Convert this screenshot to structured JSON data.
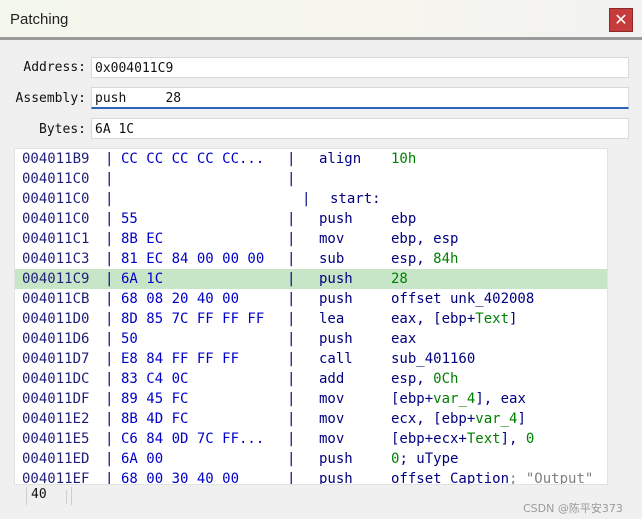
{
  "window": {
    "title": "Patching",
    "close_glyph": "✕"
  },
  "fields": {
    "address": {
      "label": "Address:",
      "value": "0x004011C9"
    },
    "assembly": {
      "label": "Assembly:",
      "value": "push     28"
    },
    "bytes": {
      "label": "Bytes:",
      "value": "6A 1C"
    }
  },
  "listing": [
    {
      "addr": "004011B9",
      "bytes": "CC CC CC CC CC...",
      "bar": "|",
      "mn": "align",
      "op": [
        {
          "t": "10h",
          "c": "num"
        }
      ]
    },
    {
      "addr": "004011C0",
      "bytes": "",
      "bar": "|",
      "mn": "",
      "op": []
    },
    {
      "addr": "004011C0",
      "bytes": "",
      "bar": "|",
      "label": "start:",
      "mn": "",
      "op": []
    },
    {
      "addr": "004011C0",
      "bytes": "55",
      "bar": "",
      "mn": "push",
      "op": [
        {
          "t": "ebp",
          "c": ""
        }
      ]
    },
    {
      "addr": "004011C1",
      "bytes": "8B EC",
      "bar": "",
      "mn": "mov",
      "op": [
        {
          "t": "ebp, esp",
          "c": ""
        }
      ]
    },
    {
      "addr": "004011C3",
      "bytes": "81 EC 84 00 00 00",
      "bar": "",
      "mn": "sub",
      "op": [
        {
          "t": "esp, ",
          "c": ""
        },
        {
          "t": "84h",
          "c": "num"
        }
      ]
    },
    {
      "addr": "004011C9",
      "bytes": "6A 1C",
      "bar": "|",
      "mn": "push",
      "op": [
        {
          "t": "28",
          "c": "num"
        }
      ],
      "selected": true
    },
    {
      "addr": "004011CB",
      "bytes": "68 08 20 40 00",
      "bar": "|",
      "mn": "push",
      "op": [
        {
          "t": "offset unk_402008",
          "c": ""
        }
      ]
    },
    {
      "addr": "004011D0",
      "bytes": "8D 85 7C FF FF FF",
      "bar": "|",
      "mn": "lea",
      "op": [
        {
          "t": "eax, [ebp+",
          "c": ""
        },
        {
          "t": "Text",
          "c": "num"
        },
        {
          "t": "]",
          "c": ""
        }
      ]
    },
    {
      "addr": "004011D6",
      "bytes": "50",
      "bar": "|",
      "mn": "push",
      "op": [
        {
          "t": "eax",
          "c": ""
        }
      ]
    },
    {
      "addr": "004011D7",
      "bytes": "E8 84 FF FF FF",
      "bar": "|",
      "mn": "call",
      "op": [
        {
          "t": "sub_401160",
          "c": ""
        }
      ]
    },
    {
      "addr": "004011DC",
      "bytes": "83 C4 0C",
      "bar": "|",
      "mn": "add",
      "op": [
        {
          "t": "esp, ",
          "c": ""
        },
        {
          "t": "0Ch",
          "c": "num"
        }
      ]
    },
    {
      "addr": "004011DF",
      "bytes": "89 45 FC",
      "bar": "|",
      "mn": "mov",
      "op": [
        {
          "t": "[ebp+",
          "c": ""
        },
        {
          "t": "var_4",
          "c": "num"
        },
        {
          "t": "], eax",
          "c": ""
        }
      ]
    },
    {
      "addr": "004011E2",
      "bytes": "8B 4D FC",
      "bar": "|",
      "mn": "mov",
      "op": [
        {
          "t": "ecx, [ebp+",
          "c": ""
        },
        {
          "t": "var_4",
          "c": "num"
        },
        {
          "t": "]",
          "c": ""
        }
      ]
    },
    {
      "addr": "004011E5",
      "bytes": "C6 84 0D 7C FF...",
      "bar": "|",
      "mn": "mov",
      "op": [
        {
          "t": "[ebp+ecx+",
          "c": ""
        },
        {
          "t": "Text",
          "c": "num"
        },
        {
          "t": "], ",
          "c": ""
        },
        {
          "t": "0",
          "c": "num"
        }
      ]
    },
    {
      "addr": "004011ED",
      "bytes": "6A 00",
      "bar": "|",
      "mn": "push",
      "op": [
        {
          "t": "0",
          "c": "num"
        },
        {
          "t": "; uType",
          "c": ""
        }
      ]
    },
    {
      "addr": "004011EF",
      "bytes": "68 00 30 40 00",
      "bar": "|",
      "mn": "push",
      "op": [
        {
          "t": "offset Caption",
          "c": ""
        },
        {
          "t": "; \"Output\"",
          "c": "gray"
        }
      ]
    }
  ],
  "status": {
    "value": "40"
  },
  "watermark": "CSDN @陈平安373",
  "colors": {
    "highlight": "#c7e6c7",
    "accent": "#2f63b8",
    "close": "#c63c3c"
  }
}
